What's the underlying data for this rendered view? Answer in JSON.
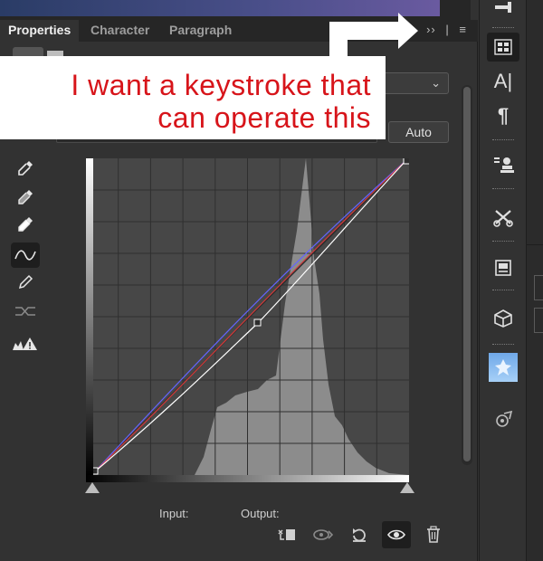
{
  "tabs": [
    {
      "label": "Properties"
    },
    {
      "label": "Character"
    },
    {
      "label": "Paragraph"
    }
  ],
  "tab_controls": {
    "collapse_glyph": "››",
    "separator": "|",
    "menu_glyph": "≡"
  },
  "buttons": {
    "auto_label": "Auto"
  },
  "labels": {
    "input": "Input:",
    "output": "Output:"
  },
  "annotation": {
    "text_line1": "I want a keystroke that",
    "text_line2": "can operate this",
    "color": "#d7141a"
  },
  "icons": {
    "tools": [
      "eyedropper-black-icon",
      "eyedropper-gray-icon",
      "eyedropper-white-icon",
      "curve-point-icon",
      "pencil-icon",
      "smooth-curve-icon",
      "clipping-warning-icon"
    ],
    "bottom": [
      "clip-to-layer-icon",
      "view-previous-state-icon",
      "reset-icon",
      "visibility-eye-icon",
      "trash-icon"
    ],
    "dock": [
      "properties-panel-icon",
      "character-panel-icon",
      "paragraph-panel-icon",
      "stamp-icon",
      "tools-icon",
      "book-icon",
      "3d-cube-icon",
      "layer-thumbnail-icon",
      "paths-icon"
    ]
  },
  "colors": {
    "panel_bg": "#323232",
    "curve_rgb": "#ffffff",
    "curve_red": "#d63a3a",
    "curve_blue": "#6464ff"
  }
}
